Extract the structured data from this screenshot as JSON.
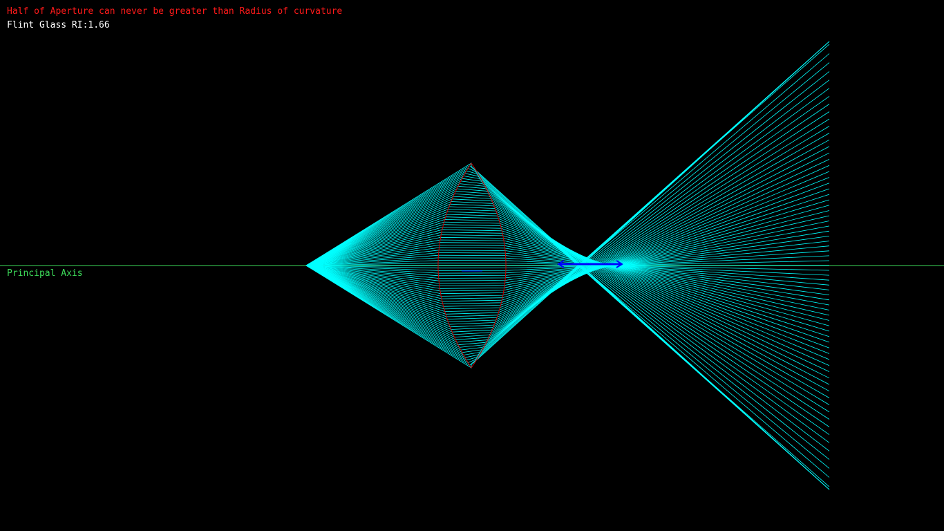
{
  "warning": {
    "text": "Half of Aperture can never be greater than Radius of curvature",
    "color": "#ff1a1a"
  },
  "material": {
    "text": "Flint Glass RI:1.66",
    "color": "#ffffff"
  },
  "principal_axis": {
    "label": "Principal Axis",
    "color": "#3ddc5a"
  },
  "colors": {
    "background": "#000000",
    "rays": "#00ffff",
    "lens_outline": "#cc0000",
    "image_marker": "#0000ff"
  },
  "lens": {
    "type": "biconvex",
    "refractive_index": 1.66
  },
  "ray_count": 40
}
